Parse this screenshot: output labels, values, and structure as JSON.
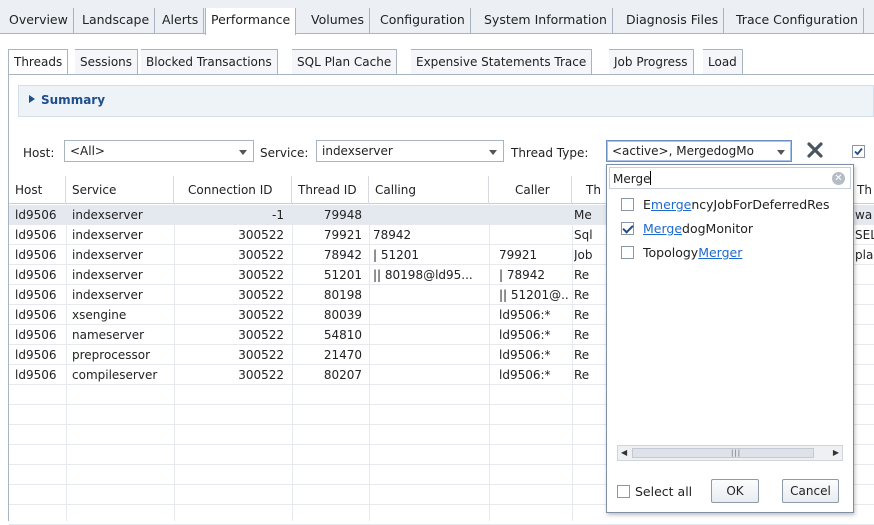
{
  "top_tabs": [
    "Overview",
    "Landscape",
    "Alerts",
    "Performance",
    "Volumes",
    "Configuration",
    "System Information",
    "Diagnosis Files",
    "Trace Configuration"
  ],
  "sub_tabs": [
    "Threads",
    "Sessions",
    "Blocked Transactions",
    "SQL Plan Cache",
    "Expensive Statements Trace",
    "Job Progress",
    "Load"
  ],
  "summary": {
    "label": "Summary"
  },
  "filters": {
    "host_label": "Host:",
    "host_value": "<All>",
    "service_label": "Service:",
    "service_value": "indexserver",
    "thread_type_label": "Thread Type:",
    "thread_type_value": "<active>, MergedogMo"
  },
  "table": {
    "columns": [
      "Host",
      "Service",
      "Connection ID",
      "Thread ID",
      "Calling",
      "Caller",
      "Th",
      "Th"
    ],
    "rows": [
      [
        "ld9506",
        "indexserver",
        "-1",
        "79948",
        "",
        "",
        "Me",
        "wa"
      ],
      [
        "ld9506",
        "indexserver",
        "300522",
        "79921",
        "78942",
        "",
        "Sql",
        "SEL"
      ],
      [
        "ld9506",
        "indexserver",
        "300522",
        "78942",
        "| 51201",
        "79921",
        "Job",
        "pla"
      ],
      [
        "ld9506",
        "indexserver",
        "300522",
        "51201",
        "|| 80198@ld95...",
        "| 78942",
        "Re",
        ""
      ],
      [
        "ld9506",
        "indexserver",
        "300522",
        "80198",
        "",
        "|| 51201@...",
        "Re",
        ""
      ],
      [
        "ld9506",
        "xsengine",
        "300522",
        "80039",
        "",
        "ld9506:*",
        "Re",
        ""
      ],
      [
        "ld9506",
        "nameserver",
        "300522",
        "54810",
        "",
        "ld9506:*",
        "Re",
        ""
      ],
      [
        "ld9506",
        "preprocessor",
        "300522",
        "21470",
        "",
        "ld9506:*",
        "Re",
        ""
      ],
      [
        "ld9506",
        "compileserver",
        "300522",
        "80207",
        "",
        "ld9506:*",
        "Re",
        ""
      ]
    ]
  },
  "popup": {
    "search_text": "Merge",
    "options": [
      {
        "pre": "E",
        "match": "merge",
        "post": "ncyJobForDeferredRes",
        "checked": false
      },
      {
        "pre": "",
        "match": "Merge",
        "post": "dogMonitor",
        "checked": true
      },
      {
        "pre": "Topology",
        "match": "Merger",
        "post": "",
        "checked": false
      }
    ],
    "select_all_label": "Select all",
    "ok_label": "OK",
    "cancel_label": "Cancel"
  }
}
